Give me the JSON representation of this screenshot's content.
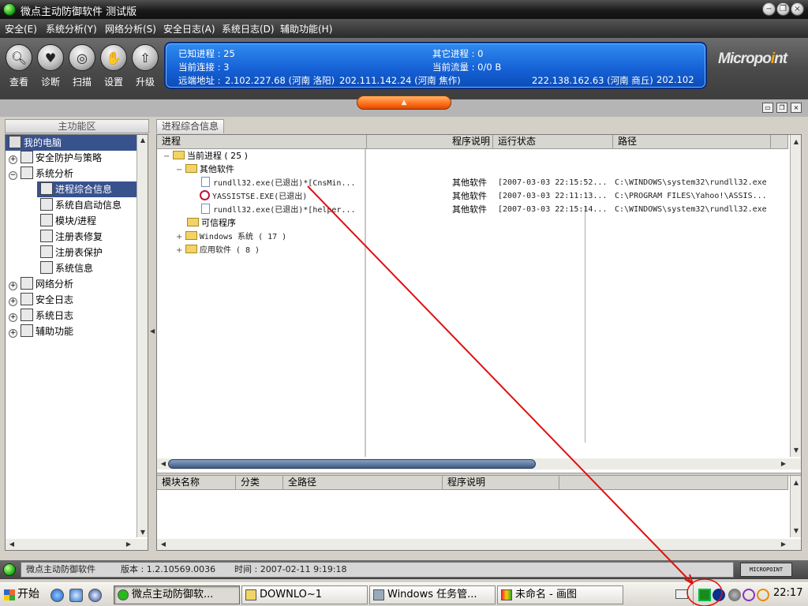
{
  "window": {
    "title": "微点主动防御软件  测试版",
    "controls": {
      "minimize": "−",
      "restore": "❐",
      "close": "×"
    }
  },
  "menubar": [
    "安全(E)",
    "系统分析(Y)",
    "网络分析(S)",
    "安全日志(A)",
    "系统日志(D)",
    "辅助功能(H)"
  ],
  "toolbar": [
    {
      "label": "查看",
      "icon": "search-icon"
    },
    {
      "label": "诊断",
      "icon": "heart-icon"
    },
    {
      "label": "扫描",
      "icon": "scan-icon"
    },
    {
      "label": "设置",
      "icon": "hand-icon"
    },
    {
      "label": "升级",
      "icon": "upgrade-icon"
    }
  ],
  "info": {
    "known_processes": "已知进程 : 25",
    "other_processes": "其它进程 : 0",
    "current_connections": "当前连接 : 3",
    "current_traffic": "当前流量 : 0/0 B",
    "remote_label": "远端地址 :",
    "remote_1": "2.102.227.68 (河南 洛阳)",
    "remote_2": "202.111.142.24 (河南 焦作)",
    "remote_3": "222.138.162.63 (河南 商丘)",
    "remote_4": "202.102"
  },
  "logo": {
    "text_a": "Micropo",
    "text_b": "i",
    "text_c": "nt"
  },
  "left_panel": {
    "header": "主功能区",
    "items": [
      {
        "label": "我的电脑",
        "level": 0,
        "expander": "",
        "selected": false
      },
      {
        "label": "安全防护与策略",
        "level": 0,
        "expander": "+",
        "selected": false
      },
      {
        "label": "系统分析",
        "level": 0,
        "expander": "−",
        "selected": false
      },
      {
        "label": "进程综合信息",
        "level": 1,
        "expander": "",
        "selected": true
      },
      {
        "label": "系统自启动信息",
        "level": 1,
        "expander": "",
        "selected": false
      },
      {
        "label": "模块/进程",
        "level": 1,
        "expander": "",
        "selected": false
      },
      {
        "label": "注册表修复",
        "level": 1,
        "expander": "",
        "selected": false
      },
      {
        "label": "注册表保护",
        "level": 1,
        "expander": "",
        "selected": false
      },
      {
        "label": "系统信息",
        "level": 1,
        "expander": "",
        "selected": false
      },
      {
        "label": "网络分析",
        "level": 0,
        "expander": "+",
        "selected": false
      },
      {
        "label": "安全日志",
        "level": 0,
        "expander": "+",
        "selected": false
      },
      {
        "label": "系统日志",
        "level": 0,
        "expander": "+",
        "selected": false
      },
      {
        "label": "辅助功能",
        "level": 0,
        "expander": "+",
        "selected": false
      }
    ]
  },
  "right_panel": {
    "tab": "进程综合信息",
    "columns": [
      "进程",
      "程序说明",
      "运行状态",
      "路径"
    ],
    "tree": [
      {
        "label": "当前进程 ( 25 )",
        "expander": "−",
        "kind": "folder"
      },
      {
        "label": "其他软件",
        "expander": "−",
        "kind": "folder"
      },
      {
        "label": "rundll32.exe(已退出)*[CnsMin...",
        "kind": "doc",
        "desc": "其他软件",
        "status": "[2007-03-03 22:15:52...",
        "path": "C:\\WINDOWS\\system32\\rundll32.exe"
      },
      {
        "label": "YASSISTSE.EXE(已退出)",
        "kind": "blocked",
        "desc": "其他软件",
        "status": "[2007-03-03 22:11:13...",
        "path": "C:\\PROGRAM FILES\\Yahoo!\\ASSIS..."
      },
      {
        "label": "rundll32.exe(已退出)*[helper...",
        "kind": "doc",
        "desc": "其他软件",
        "status": "[2007-03-03 22:15:14...",
        "path": "C:\\WINDOWS\\system32\\rundll32.exe"
      },
      {
        "label": "可信程序",
        "expander": "",
        "kind": "folder"
      },
      {
        "label": "Windows 系统 ( 17 )",
        "expander": "+",
        "kind": "folder"
      },
      {
        "label": "应用软件 ( 8 )",
        "expander": "+",
        "kind": "folder"
      }
    ],
    "module_columns": [
      "模块名称",
      "分类",
      "全路径",
      "程序说明"
    ]
  },
  "statusbar": {
    "app": "微点主动防御软件",
    "version": "版本 : 1.2.10569.0036",
    "time": "时间 : 2007-02-11  9:19:18",
    "brand": "MICROPOINT"
  },
  "taskbar": {
    "start": "开始",
    "tasks": [
      {
        "label": "微点主动防御软...",
        "active": true
      },
      {
        "label": "DOWNLO~1",
        "active": false
      },
      {
        "label": "Windows 任务管...",
        "active": false
      },
      {
        "label": "未命名 - 画图",
        "active": false
      }
    ],
    "clock": "22:17"
  },
  "colors": {
    "accent_blue": "#1560d4",
    "title_dark": "#1a1a1a",
    "orange": "#ff6e1a",
    "selection": "#38528e",
    "annotation_red": "#e01010"
  }
}
